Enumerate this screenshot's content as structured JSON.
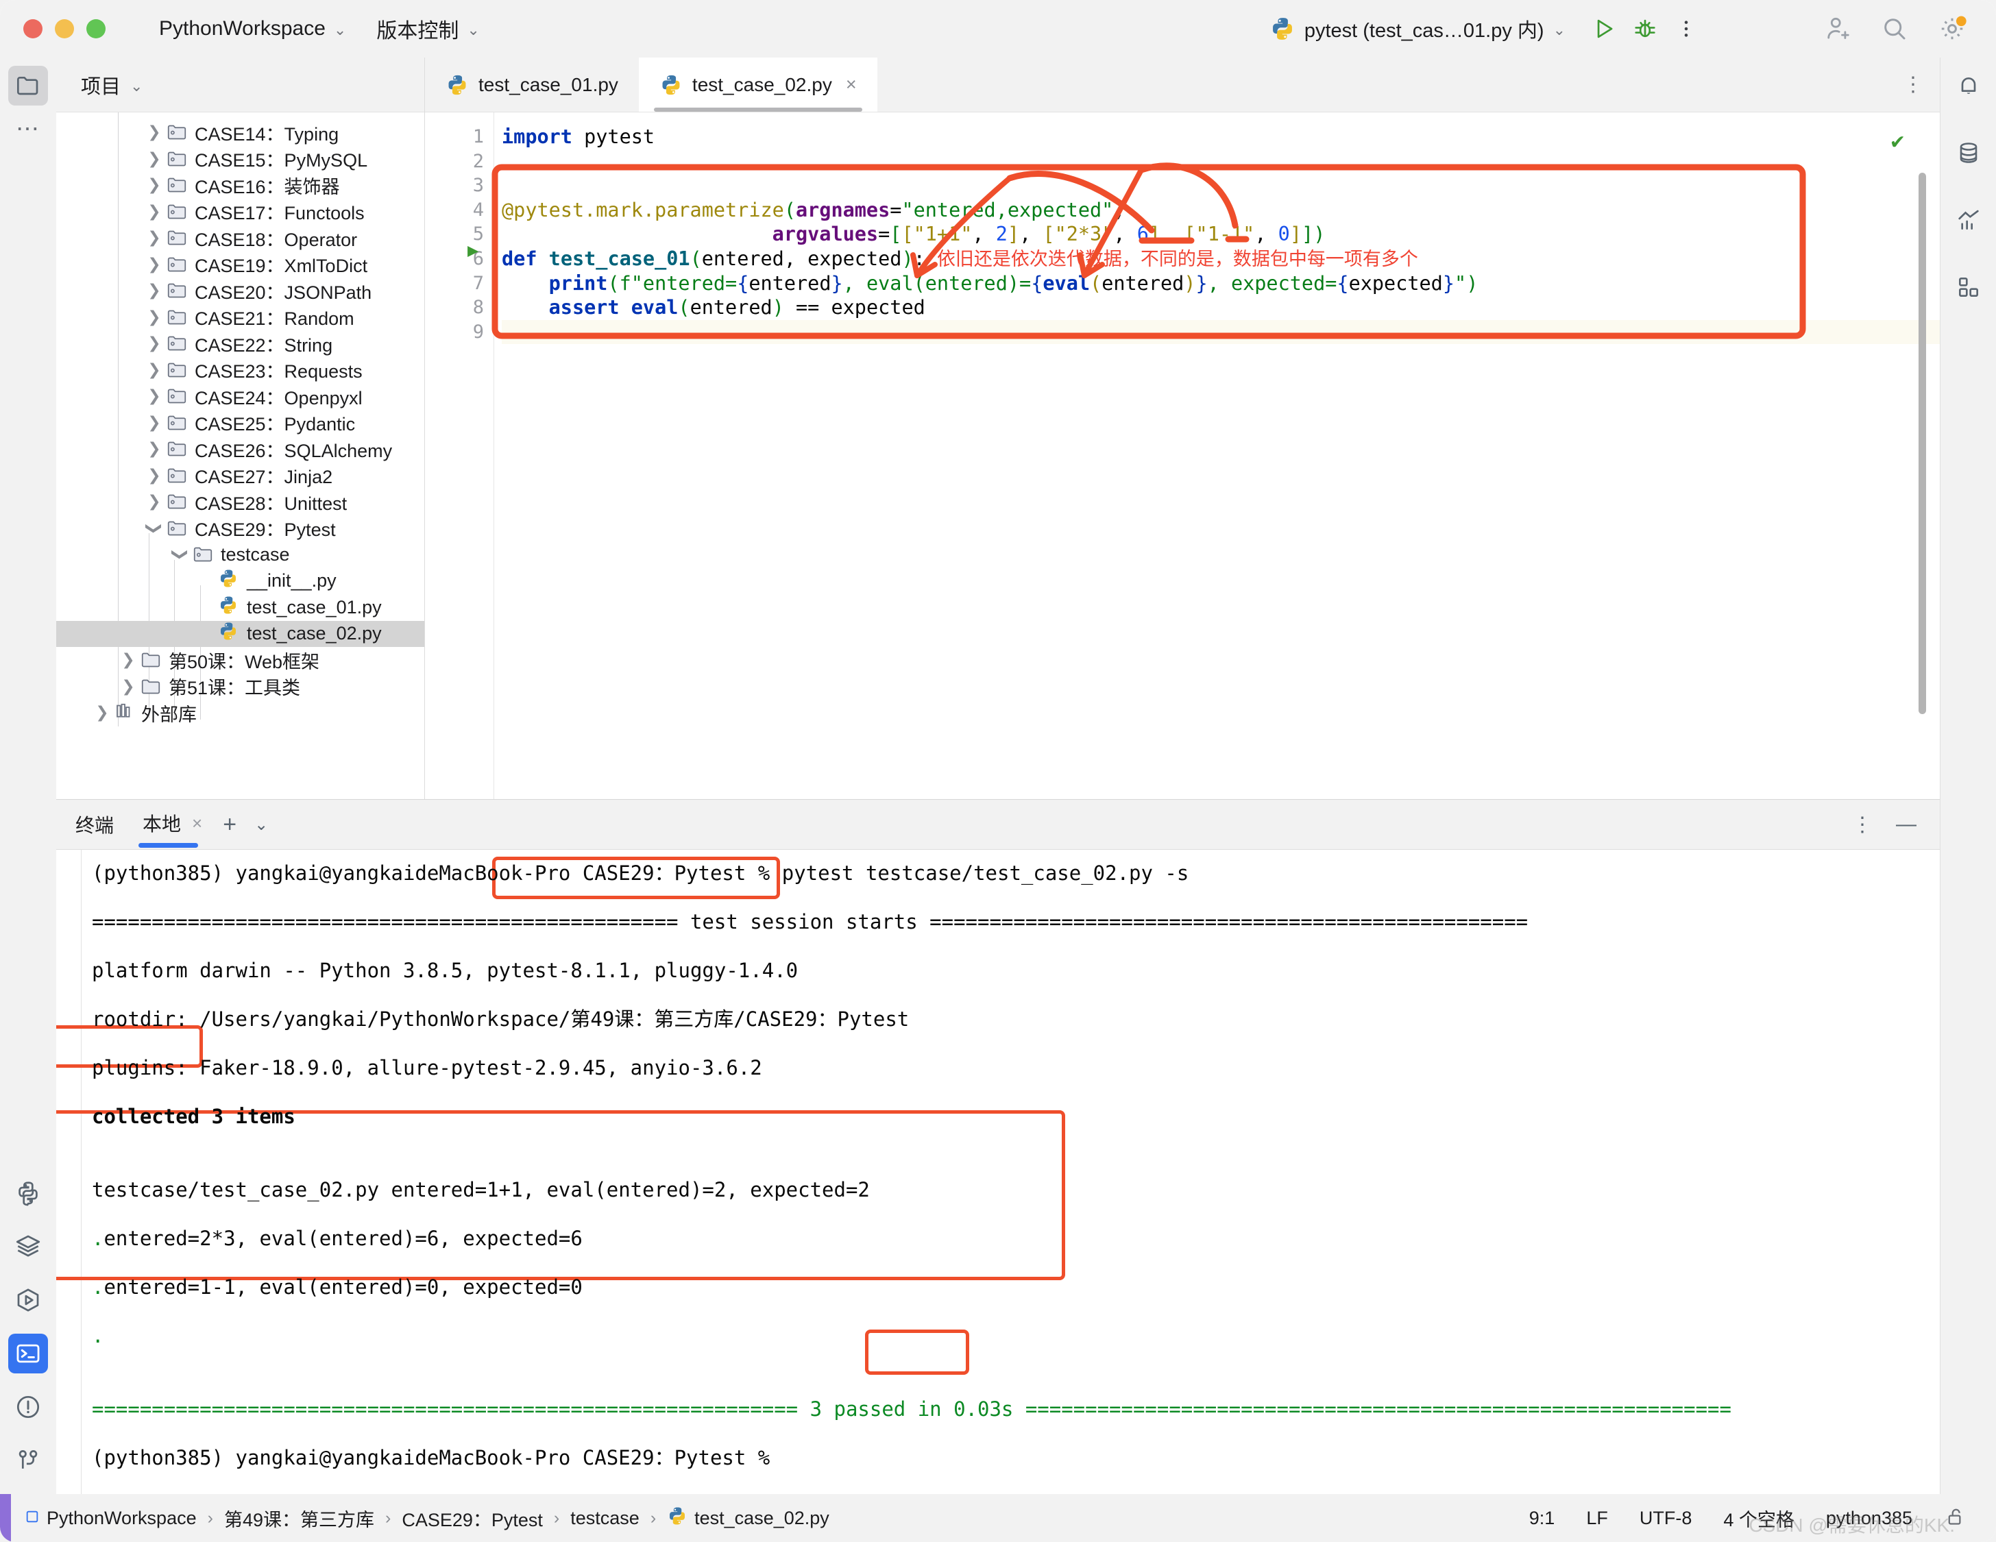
{
  "window": {
    "project_name": "PythonWorkspace",
    "vcs_label": "版本控制",
    "run_config": "pytest (test_cas…01.py 内)"
  },
  "toolbar_icons": {
    "run": "run-play-icon",
    "debug": "debug-bug-icon",
    "more": "more-vertical-icon",
    "account": "add-account-icon",
    "search": "search-icon",
    "settings": "gear-icon"
  },
  "project_panel": {
    "header": "项目",
    "tree": [
      {
        "label": "CASE14：Typing",
        "indent": 1,
        "type": "folder",
        "state": "collapsed"
      },
      {
        "label": "CASE15：PyMySQL",
        "indent": 1,
        "type": "folder",
        "state": "collapsed"
      },
      {
        "label": "CASE16：装饰器",
        "indent": 1,
        "type": "folder",
        "state": "collapsed"
      },
      {
        "label": "CASE17：Functools",
        "indent": 1,
        "type": "folder",
        "state": "collapsed"
      },
      {
        "label": "CASE18：Operator",
        "indent": 1,
        "type": "folder",
        "state": "collapsed"
      },
      {
        "label": "CASE19：XmlToDict",
        "indent": 1,
        "type": "folder",
        "state": "collapsed"
      },
      {
        "label": "CASE20：JSONPath",
        "indent": 1,
        "type": "folder",
        "state": "collapsed"
      },
      {
        "label": "CASE21：Random",
        "indent": 1,
        "type": "folder",
        "state": "collapsed"
      },
      {
        "label": "CASE22：String",
        "indent": 1,
        "type": "folder",
        "state": "collapsed"
      },
      {
        "label": "CASE23：Requests",
        "indent": 1,
        "type": "folder",
        "state": "collapsed"
      },
      {
        "label": "CASE24：Openpyxl",
        "indent": 1,
        "type": "folder",
        "state": "collapsed"
      },
      {
        "label": "CASE25：Pydantic",
        "indent": 1,
        "type": "folder",
        "state": "collapsed"
      },
      {
        "label": "CASE26：SQLAlchemy",
        "indent": 1,
        "type": "folder",
        "state": "collapsed"
      },
      {
        "label": "CASE27：Jinja2",
        "indent": 1,
        "type": "folder",
        "state": "collapsed"
      },
      {
        "label": "CASE28：Unittest",
        "indent": 1,
        "type": "folder",
        "state": "collapsed"
      },
      {
        "label": "CASE29：Pytest",
        "indent": 1,
        "type": "folder",
        "state": "expanded"
      },
      {
        "label": "testcase",
        "indent": 2,
        "type": "folder",
        "state": "expanded"
      },
      {
        "label": "__init__.py",
        "indent": 3,
        "type": "python",
        "state": "none"
      },
      {
        "label": "test_case_01.py",
        "indent": 3,
        "type": "python",
        "state": "none"
      },
      {
        "label": "test_case_02.py",
        "indent": 3,
        "type": "python",
        "state": "none",
        "selected": true
      },
      {
        "label": "第50课：Web框架",
        "indent": 0,
        "type": "plainfolder",
        "state": "collapsed"
      },
      {
        "label": "第51课：工具类",
        "indent": 0,
        "type": "plainfolder",
        "state": "collapsed"
      },
      {
        "label": "外部库",
        "indent": -1,
        "type": "library",
        "state": "collapsed"
      }
    ]
  },
  "editor": {
    "tabs": [
      {
        "label": "test_case_01.py",
        "active": false,
        "closable": false
      },
      {
        "label": "test_case_02.py",
        "active": true,
        "closable": true
      }
    ],
    "line_numbers": [
      "1",
      "2",
      "3",
      "4",
      "5",
      "6",
      "7",
      "8",
      "9"
    ],
    "code": {
      "l1_import": "import",
      "l1_module": " pytest",
      "l4_decorator": "@pytest.mark.parametrize",
      "l4_argnames_kw": "argnames",
      "l4_argnames_val": "\"entered,expected\"",
      "l5_argvalues_kw": "argvalues",
      "l5_list": "[[\"1+1\", 2], [\"2*3\", 6], [\"1-1\", 0]])",
      "l6_def": "def",
      "l6_name": "test_case_01",
      "l6_args": "(entered, expected):",
      "l6_comment": "依旧还是依次迭代数据，不同的是，数据包中每一项有多个",
      "l7_print": "print(f\"entered={entered}, eval(entered)={eval(entered)}, expected={expected}\")",
      "l8_assert_kw": "assert",
      "l8_assert_rest": " eval(entered) == expected"
    },
    "inspection_status": "✔"
  },
  "terminal": {
    "title": "终端",
    "tab_label": "本地",
    "close_glyph": "×",
    "plus_glyph": "+",
    "chevron_glyph": "⌄",
    "more_glyph": "⋮",
    "minimize_glyph": "—",
    "lines": [
      {
        "text": "(python385) yangkai@yangkaideMacBook-Pro CASE29：Pytest % pytest testcase/test_case_02.py -s",
        "color": "black"
      },
      {
        "text": "================================================= test session starts ==================================================",
        "color": "black"
      },
      {
        "text": "platform darwin -- Python 3.8.5, pytest-8.1.1, pluggy-1.4.0",
        "color": "black"
      },
      {
        "text": "rootdir: /Users/yangkai/PythonWorkspace/第49课：第三方库/CASE29：Pytest",
        "color": "black"
      },
      {
        "text": "plugins: Faker-18.9.0, allure-pytest-2.9.45, anyio-3.6.2",
        "color": "black"
      },
      {
        "text": "collected 3 items",
        "color": "black",
        "bold": true
      },
      {
        "text": "",
        "color": "black"
      },
      {
        "text": "testcase/test_case_02.py entered=1+1, eval(entered)=2, expected=2",
        "color": "black"
      },
      {
        "text": ".entered=2*3, eval(entered)=6, expected=6",
        "color": "black",
        "lead_green": true
      },
      {
        "text": ".entered=1-1, eval(entered)=0, expected=0",
        "color": "black",
        "lead_green": true
      },
      {
        "text": ".",
        "color": "green"
      },
      {
        "text": "",
        "color": "black"
      },
      {
        "text": "=========================================================== 3 passed in 0.03s ===========================================================",
        "color": "green"
      },
      {
        "text": "(python385) yangkai@yangkaideMacBook-Pro CASE29：Pytest % ",
        "color": "black"
      }
    ],
    "command": "pytest testcase/test_case_02.py -s",
    "collected": "collected 3 items",
    "passed": "3 passed"
  },
  "status_bar": {
    "breadcrumbs": [
      "PythonWorkspace",
      "第49课：第三方库",
      "CASE29：Pytest",
      "testcase",
      "test_case_02.py"
    ],
    "separator": "›",
    "caret": "9:1",
    "line_sep": "LF",
    "encoding": "UTF-8",
    "indent": "4 个空格",
    "interpreter": "python385",
    "lock_icon": "lock-open-icon",
    "watermark": "CSDN @需要休息的KK."
  },
  "left_rail_icons": [
    "project-folder-icon",
    "more-dots-icon",
    "python-console-icon",
    "structure-layers-icon",
    "run-hexagon-icon",
    "terminal-icon",
    "problems-icon",
    "git-branch-icon"
  ],
  "right_rail_icons": [
    "notifications-bell-icon",
    "database-icon",
    "profiler-chart-icon",
    "plugins-grid-icon"
  ],
  "colors": {
    "annotation_red": "#ef4e2b",
    "accent_blue": "#3574f0",
    "pass_green": "#0c8a24"
  }
}
